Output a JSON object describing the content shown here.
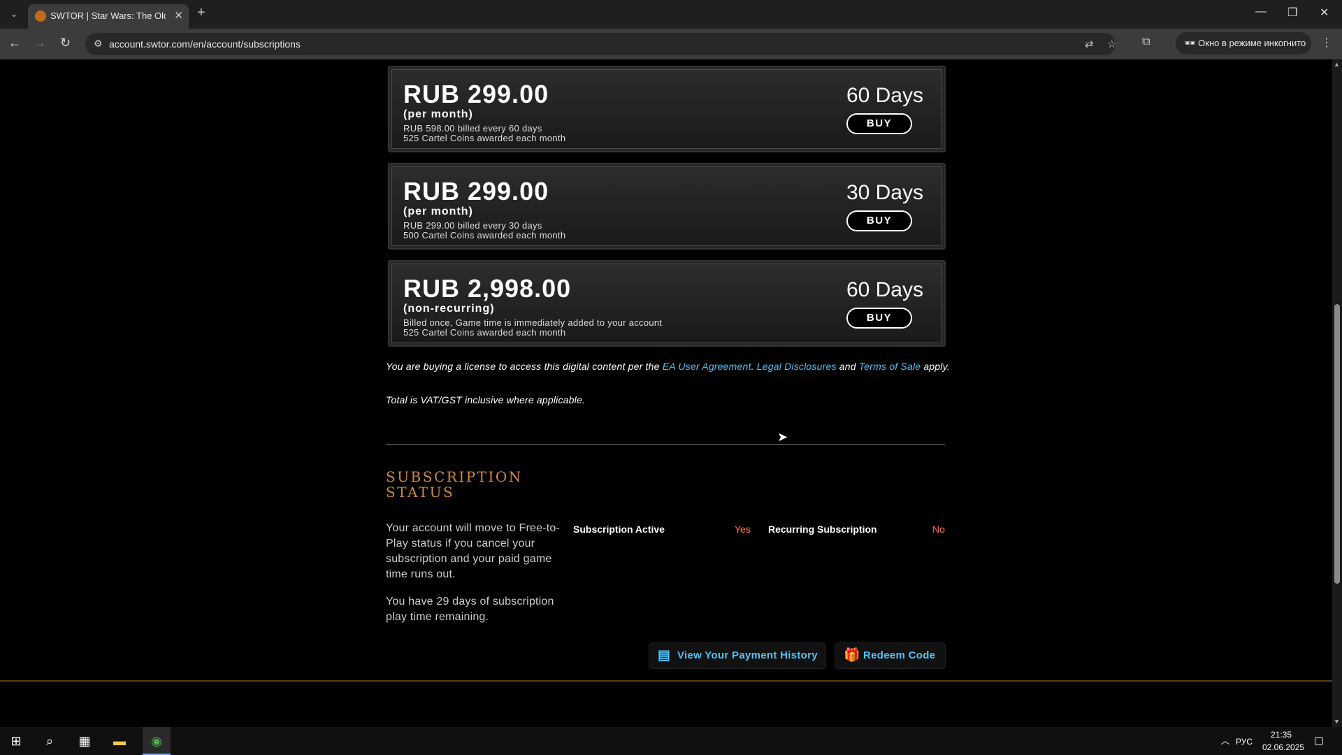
{
  "browser": {
    "tab_title": "SWTOR | Star Wars: The Old Republic",
    "url": "account.swtor.com/en/account/subscriptions",
    "incognito_label": "Окно в режиме инкогнито"
  },
  "plans": [
    {
      "price": "RUB 299.00",
      "period": "(per month)",
      "detail1": "RUB 598.00 billed every 60 days",
      "detail2": "525 Cartel Coins awarded each month",
      "days": "60 Days",
      "buy": "BUY"
    },
    {
      "price": "RUB 299.00",
      "period": "(per month)",
      "detail1": "RUB 299.00 billed every 30 days",
      "detail2": "500 Cartel Coins awarded each month",
      "days": "30 Days",
      "buy": "BUY"
    },
    {
      "price": "RUB 2,998.00",
      "period": "(non-recurring)",
      "detail1": "Billed once, Game time is immediately added to your account",
      "detail2": "525 Cartel Coins awarded each month",
      "days": "60 Days",
      "buy": "BUY"
    }
  ],
  "legal": {
    "prefix": "You are buying a license to access this digital content per the ",
    "link1": "EA User Agreement",
    "sep": ". ",
    "link2": "Legal Disclosures",
    "and": " and ",
    "link3": "Terms of Sale",
    "suffix": " apply.",
    "vat": "Total is VAT/GST inclusive where applicable."
  },
  "status": {
    "title": "SUBSCRIPTION STATUS",
    "text1": "Your account will move to Free-to-Play status if you cancel your subscription and your paid game time runs out.",
    "text2": "You have 29 days of subscription play time remaining.",
    "active_label": "Subscription Active",
    "active_value": "Yes",
    "recurring_label": "Recurring Subscription",
    "recurring_value": "No"
  },
  "actions": {
    "payment_history": "View Your Payment History",
    "redeem": "Redeem Code"
  },
  "taskbar": {
    "lang": "РУС",
    "time": "21:35",
    "date": "02.06.2025"
  }
}
